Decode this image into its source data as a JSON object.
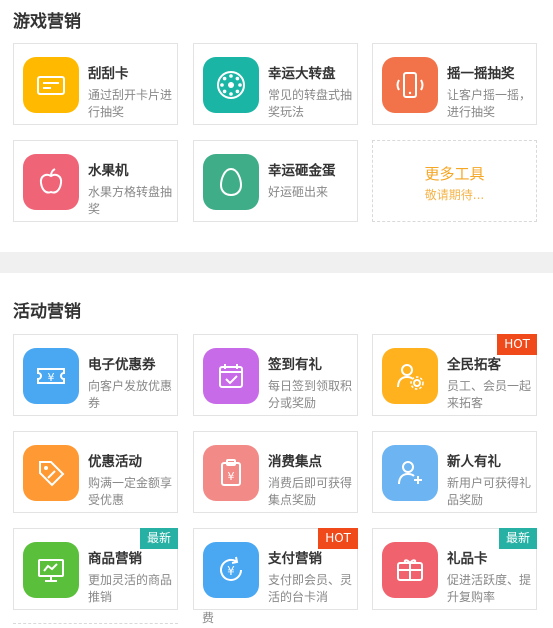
{
  "sections": [
    {
      "title": "游戏营销",
      "cards": [
        {
          "name": "刮刮卡",
          "desc": "通过刮开卡片进行抽奖",
          "icon": "scratch-card-icon",
          "color": "#ffba00"
        },
        {
          "name": "幸运大转盘",
          "desc": "常见的转盘式抽奖玩法",
          "icon": "wheel-icon",
          "color": "#1ab5a5"
        },
        {
          "name": "摇一摇抽奖",
          "desc": "让客户摇一摇，进行抽奖",
          "icon": "shake-phone-icon",
          "color": "#f2734a"
        },
        {
          "name": "水果机",
          "desc": "水果方格转盘抽奖",
          "icon": "apple-icon",
          "color": "#f06478"
        },
        {
          "name": "幸运砸金蛋",
          "desc": "好运砸出来",
          "icon": "egg-icon",
          "color": "#3fae88"
        }
      ],
      "more": {
        "title": "更多工具",
        "subtitle": "敬请期待..."
      }
    },
    {
      "title": "活动营销",
      "cards": [
        {
          "name": "电子优惠券",
          "desc": "向客户发放优惠券",
          "icon": "coupon-icon",
          "color": "#4aa8f2"
        },
        {
          "name": "签到有礼",
          "desc": "每日签到领取积分或奖励",
          "icon": "calendar-check-icon",
          "color": "#c86be8"
        },
        {
          "name": "全民拓客",
          "desc": "员工、会员一起来拓客",
          "icon": "user-gear-icon",
          "color": "#ffb21e",
          "badge": "HOT"
        },
        {
          "name": "优惠活动",
          "desc": "购满一定金额享受优惠",
          "icon": "discount-tag-icon",
          "color": "#ff9933"
        },
        {
          "name": "消费集点",
          "desc": "消费后即可获得集点奖励",
          "icon": "receipt-yen-icon",
          "color": "#f28b87"
        },
        {
          "name": "新人有礼",
          "desc": "新用户可获得礼品奖励",
          "icon": "user-add-icon",
          "color": "#6cb4f2"
        },
        {
          "name": "商品营销",
          "desc": "更加灵活的商品推销",
          "icon": "monitor-icon",
          "color": "#5abf3a",
          "badge": "最新"
        },
        {
          "name": "支付营销",
          "desc": "支付即会员、灵活的台卡消",
          "icon": "pay-yen-icon",
          "color": "#4aa8f2",
          "badge": "HOT"
        },
        {
          "name": "礼品卡",
          "desc": "促进活跃度、提升复购率",
          "icon": "gift-card-icon",
          "color": "#f0626e",
          "badge": "最新"
        }
      ]
    }
  ],
  "overflow_text": "费"
}
